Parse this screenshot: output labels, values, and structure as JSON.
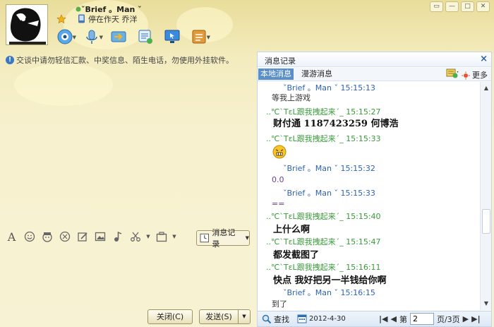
{
  "header": {
    "user_name": "ˇBrief 。Man ˇ",
    "user_sign": "停在作天 乔洋",
    "window_controls": [
      "▭",
      "—",
      "□",
      "✕"
    ]
  },
  "toolbar": {
    "icons": [
      "video-call-icon",
      "voice-call-icon",
      "send-file-icon",
      "remote-assist-icon",
      "share-screen-icon",
      "app-menu-icon"
    ]
  },
  "notice": "交谈中请勿轻信汇款、中奖信息、陌生电话，勿使用外挂软件。",
  "input_toolbar": {
    "history_label": "消息记录",
    "close_label": "关闭(C)",
    "send_label": "发送(S)"
  },
  "panel": {
    "title": "消息记录",
    "close": "×",
    "tab_local": "本地消息",
    "tab_roam": "漫游消息",
    "more": "更多",
    "messages": [
      {
        "sender": "ˇBrief 。Man ˇ",
        "time": "15:15:13",
        "text": "等我上游戏",
        "color": "brief",
        "bold": false
      },
      {
        "sender": "..℃ˋTεL跟我拽起来ˊ_",
        "time": "15:15:27",
        "text": "财付通   1187423259     何博浩",
        "color": "green",
        "bold": true
      },
      {
        "sender": "..℃ˋTεL跟我拽起来ˊ_",
        "time": "15:15:33",
        "text": "",
        "color": "green",
        "bold": false,
        "emoji": true
      },
      {
        "sender": "ˇBrief 。Man ˇ",
        "time": "15:15:32",
        "text": "0.0",
        "color": "brief",
        "bold": false
      },
      {
        "sender": "ˇBrief 。Man ˇ",
        "time": "15:15:33",
        "text": "==",
        "color": "brief",
        "bold": false
      },
      {
        "sender": "..℃ˋTεL跟我拽起来ˊ_",
        "time": "15:15:40",
        "text": "上什么啊",
        "color": "green",
        "bold": true
      },
      {
        "sender": "..℃ˋTεL跟我拽起来ˊ_",
        "time": "15:15:47",
        "text": "都发截图了",
        "color": "green",
        "bold": true
      },
      {
        "sender": "..℃ˋTεL跟我拽起来ˊ_",
        "time": "15:16:11",
        "text": "快点 我好把另一半钱给你啊",
        "color": "green",
        "bold": true
      },
      {
        "sender": "ˇBrief 。Man ˇ",
        "time": "15:16:15",
        "text": "到了",
        "color": "brief",
        "bold": false
      }
    ],
    "footer": {
      "search": "查找",
      "date": "2012-4-30",
      "page_prefix": "第",
      "page_value": "2",
      "page_suffix": "页/3页"
    }
  }
}
